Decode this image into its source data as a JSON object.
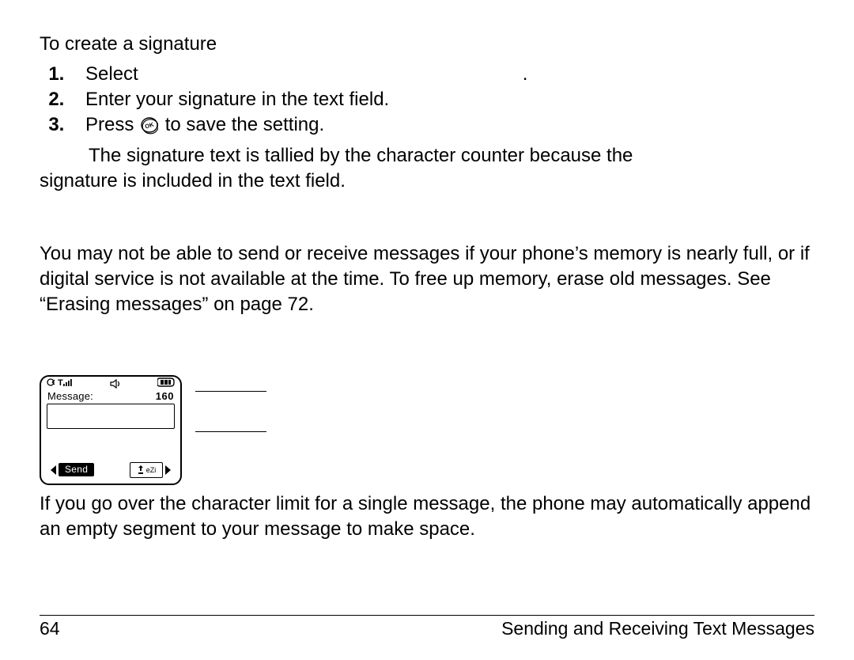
{
  "intro": "To create a signature",
  "steps": {
    "s1_prefix": "Select",
    "s1_trailing": ".",
    "s2": "Enter your signature in the text field.",
    "s3_before": "Press",
    "s3_after": " to save the setting."
  },
  "ok_icon_name": "ok-button-icon",
  "note_line1": "The signature text is tallied by the character counter because the",
  "note_line2": "signature is included in the text field.",
  "memory_para": "You may not be able to send or receive messages if your phone’s memory is nearly full, or if digital service is not available at the time. To free up memory, erase old messages. See “Erasing messages” on page 72.",
  "phone_screen": {
    "label": "Message:",
    "char_count": "160",
    "send_label": "Send",
    "mode_indicator": "eZi"
  },
  "after_screen": "If you go over the character limit for a single message, the phone may automatically append an empty segment to your message to make space.",
  "footer": {
    "page_number": "64",
    "section_title": "Sending and Receiving Text Messages"
  }
}
